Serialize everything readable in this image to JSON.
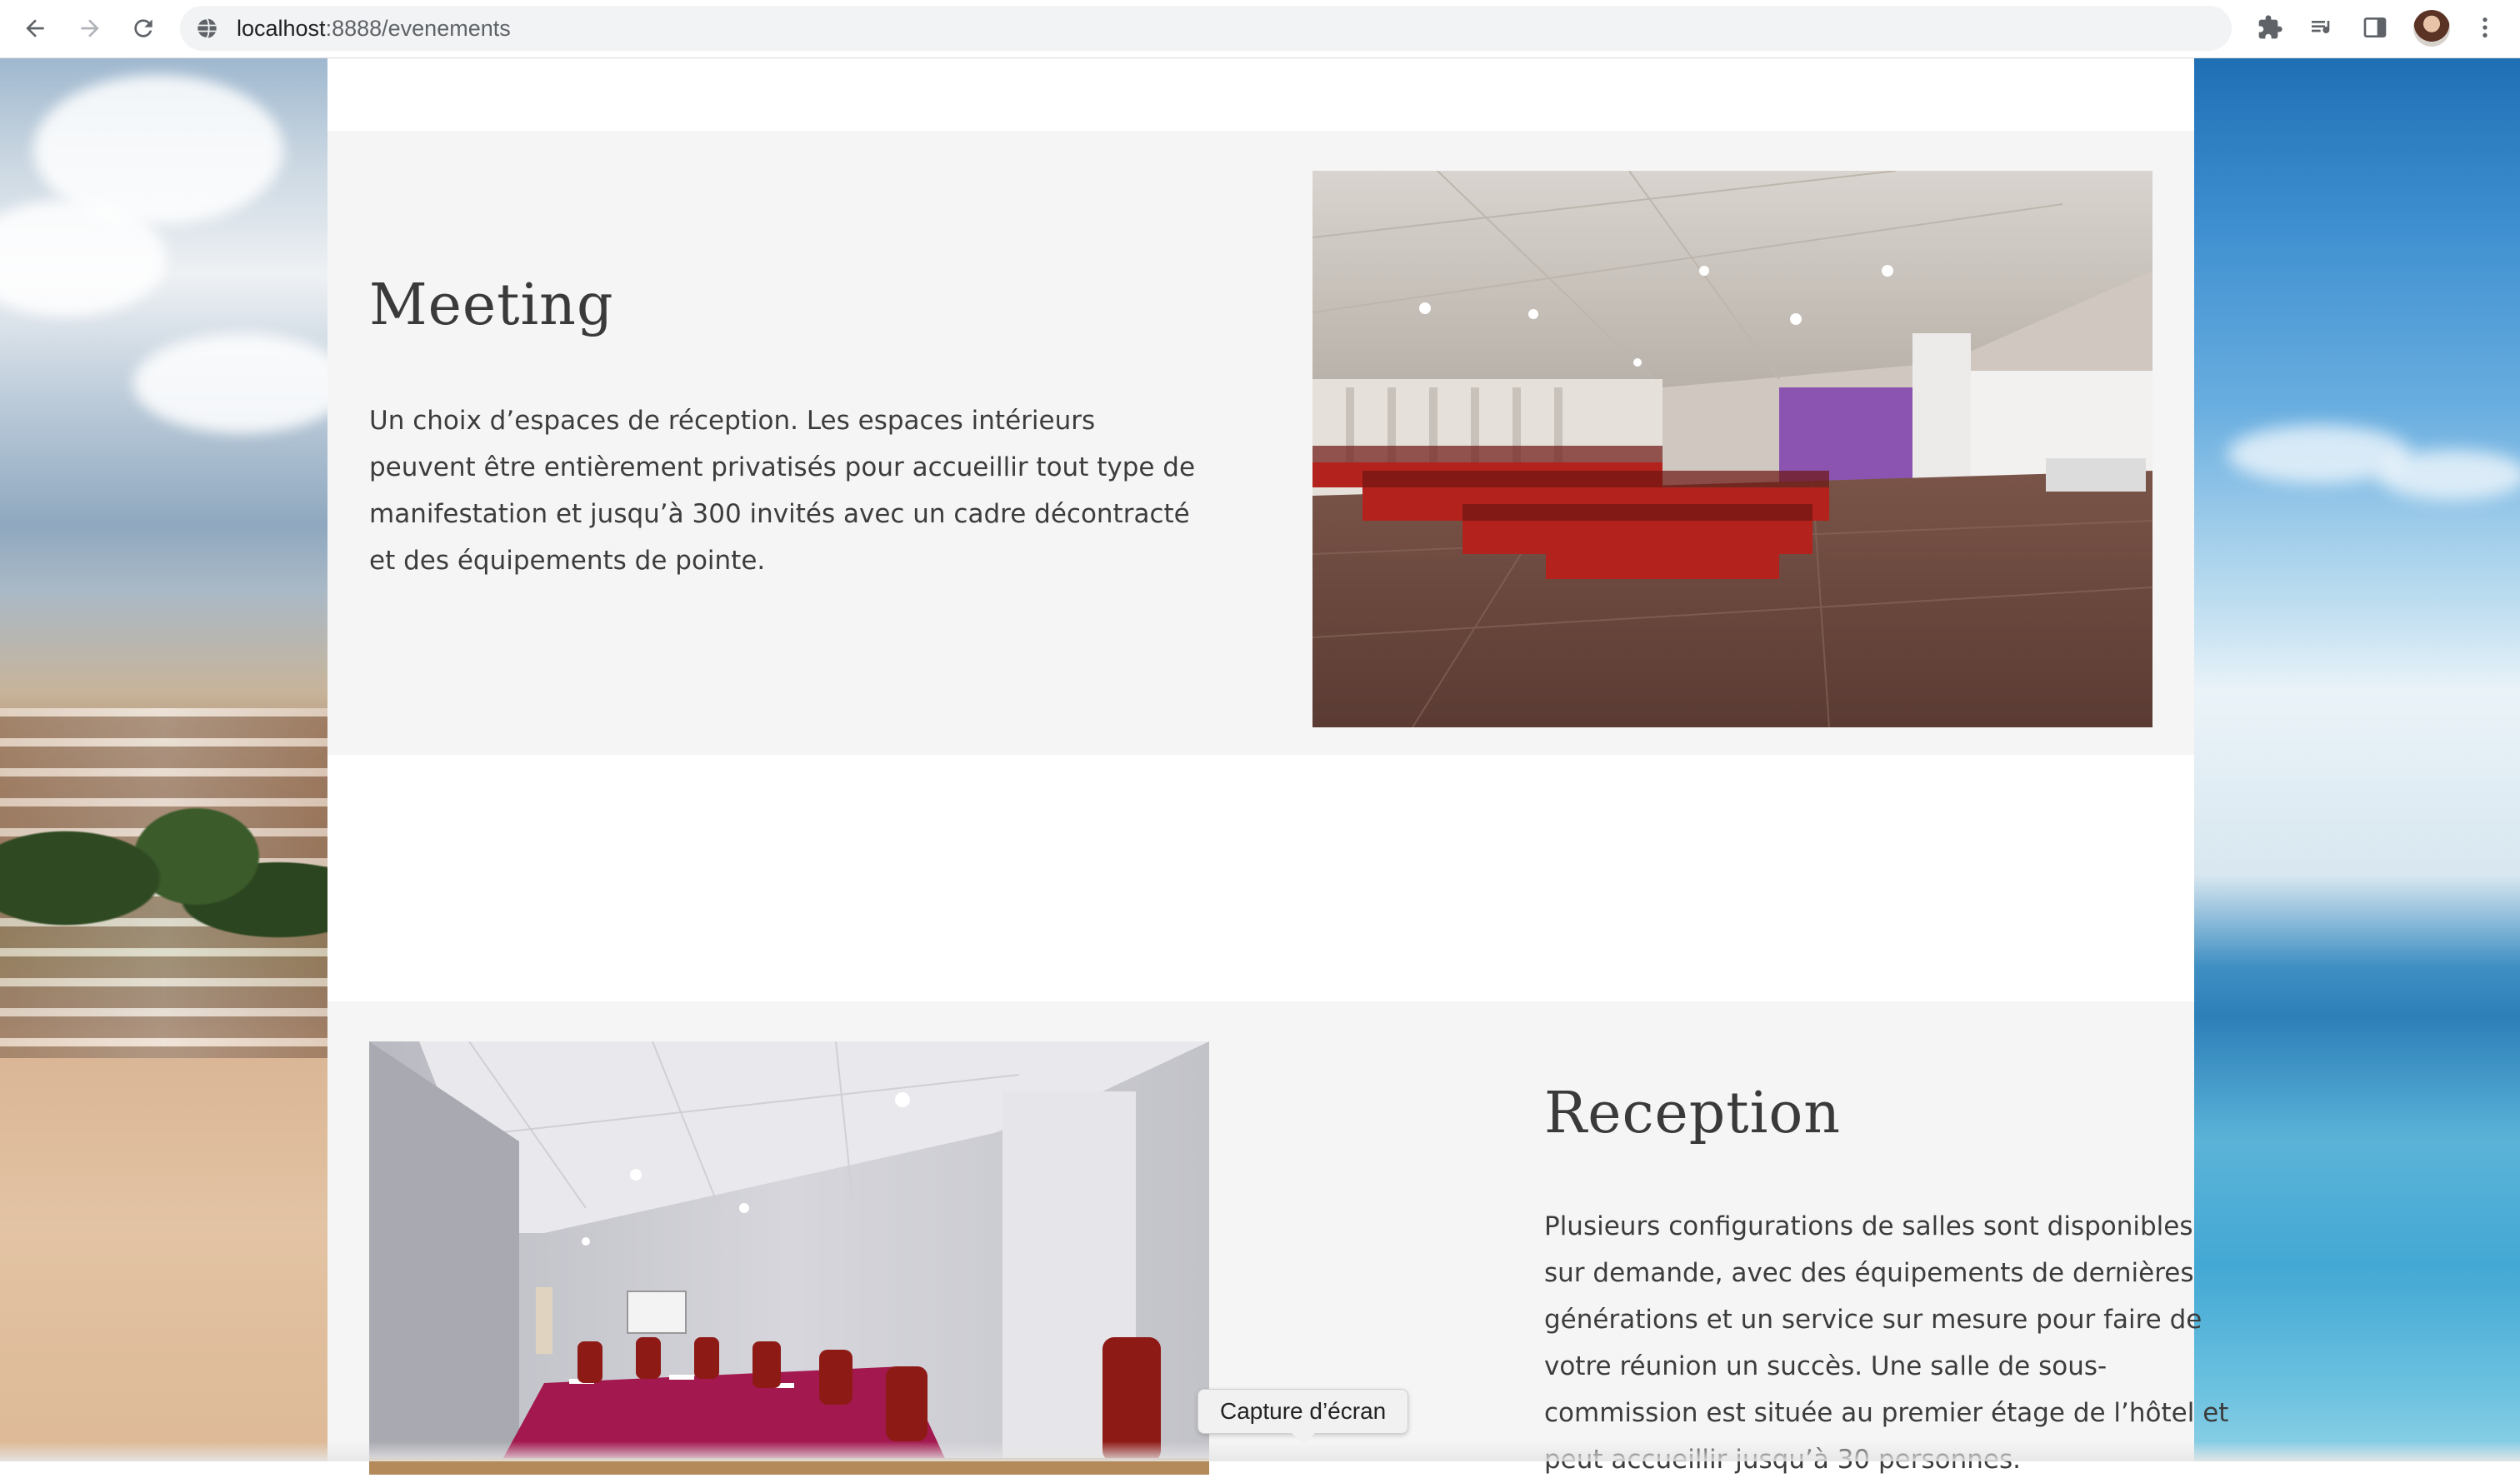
{
  "browser": {
    "url_host": "localhost",
    "url_path": ":8888/evenements",
    "icons": {
      "back": "arrow-left-icon",
      "forward": "arrow-right-icon",
      "reload": "reload-icon",
      "site": "site-info-icon",
      "extensions": "puzzle-icon",
      "reading_list": "reading-list-icon",
      "side_panel": "side-panel-icon",
      "profile": "avatar",
      "menu": "kebab-menu-icon"
    }
  },
  "sections": {
    "meeting": {
      "title": "Meeting",
      "text": "Un choix d’espaces de réception. Les espaces intérieurs peuvent être entièrement privatisés pour accueillir tout type de manifestation et jusqu’à 300 invités avec un cadre décontracté et des équipements de pointe."
    },
    "reception": {
      "title": "Reception",
      "text": "Plusieurs configurations de salles sont disponibles sur demande, avec des équipements de dernières générations et un service sur mesure pour faire de votre réunion un succès. Une salle de sous-commission est située au premier étage de l’hôtel et peut accueillir jusqu’à 30 personnes."
    }
  },
  "tooltip": {
    "text": "Capture d’écran"
  },
  "colors": {
    "band_background": "#f5f5f5",
    "title": "#3a3a3a",
    "text": "#3c3c3c",
    "chair_red": "#b3221c",
    "table_magenta": "#a3194f"
  }
}
